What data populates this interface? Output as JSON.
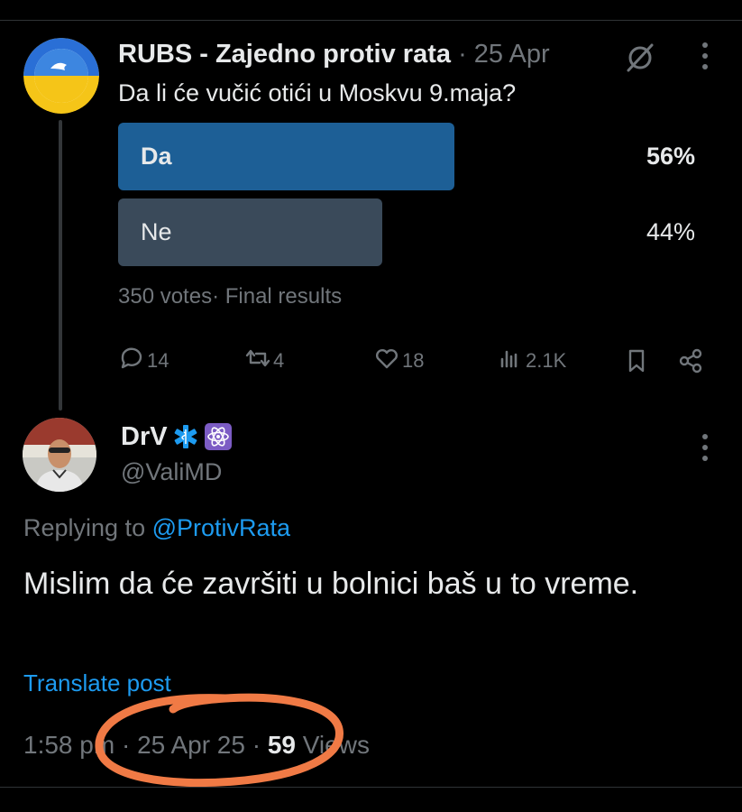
{
  "quoted_post": {
    "author_name": "RUBS - Zajedno protiv rata",
    "separator": "·",
    "date": "25 Apr",
    "text": "Da li će vučić otići u Moskvu 9.maja?",
    "poll": {
      "options": [
        {
          "label": "Da",
          "percent_text": "56%",
          "share": 0.56
        },
        {
          "label": "Ne",
          "percent_text": "44%",
          "share": 0.44
        }
      ],
      "votes": "350 votes",
      "status": "· Final results"
    },
    "actions": {
      "replies": "14",
      "reposts": "4",
      "likes": "18",
      "views": "2.1K"
    }
  },
  "reply_post": {
    "author_name": "DrV",
    "handle": "@ValiMD",
    "replying_prefix": "Replying to ",
    "replying_to": "@ProtivRata",
    "text": "Mislim da će završiti u bolnici baš u to vreme.",
    "translate": "Translate post",
    "time": "1:58 pm",
    "date": "25 Apr 25",
    "views_count": "59",
    "views_label": "Views"
  },
  "colors": {
    "background": "#000000",
    "accent_blue": "#1d9bf0",
    "poll_winner": "#1d5f96",
    "poll_other": "#3a4a5a",
    "muted": "#71767b",
    "annotation_circle": "#f07a45"
  },
  "icons": [
    "grok-icon",
    "more-icon",
    "reply-icon",
    "repost-icon",
    "like-icon",
    "views-icon",
    "bookmark-icon",
    "share-icon",
    "medical-star-icon",
    "atom-icon"
  ]
}
